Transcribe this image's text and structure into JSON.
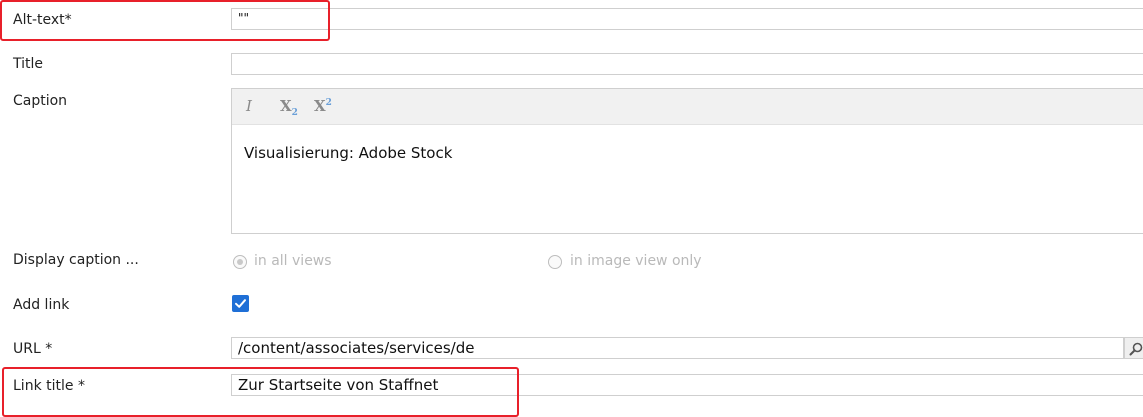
{
  "fields": {
    "alt_text": {
      "label": "Alt-text*",
      "value": "\"\""
    },
    "title": {
      "label": "Title",
      "value": ""
    },
    "caption": {
      "label": "Caption",
      "toolbar": {
        "italic": "I",
        "subscript": "X",
        "superscript": "X",
        "sub_digit": "2",
        "sup_digit": "2"
      },
      "value": "Visualisierung: Adobe Stock"
    },
    "display_caption": {
      "label": "Display caption ...",
      "options": [
        "in all views",
        "in image view only"
      ],
      "selected": "in all views"
    },
    "add_link": {
      "label": "Add link",
      "checked": true
    },
    "url": {
      "label": "URL *",
      "value": "/content/associates/services/de"
    },
    "link_title": {
      "label": "Link title *",
      "value": "Zur Startseite von Staffnet"
    }
  },
  "colors": {
    "highlight": "#e8202a",
    "checkbox": "#1f6fd6",
    "toolbar_bg": "#f1f1f1"
  },
  "icons": {
    "url_browse": "search-icon",
    "add_link_checkbox": "checkmark-icon"
  }
}
